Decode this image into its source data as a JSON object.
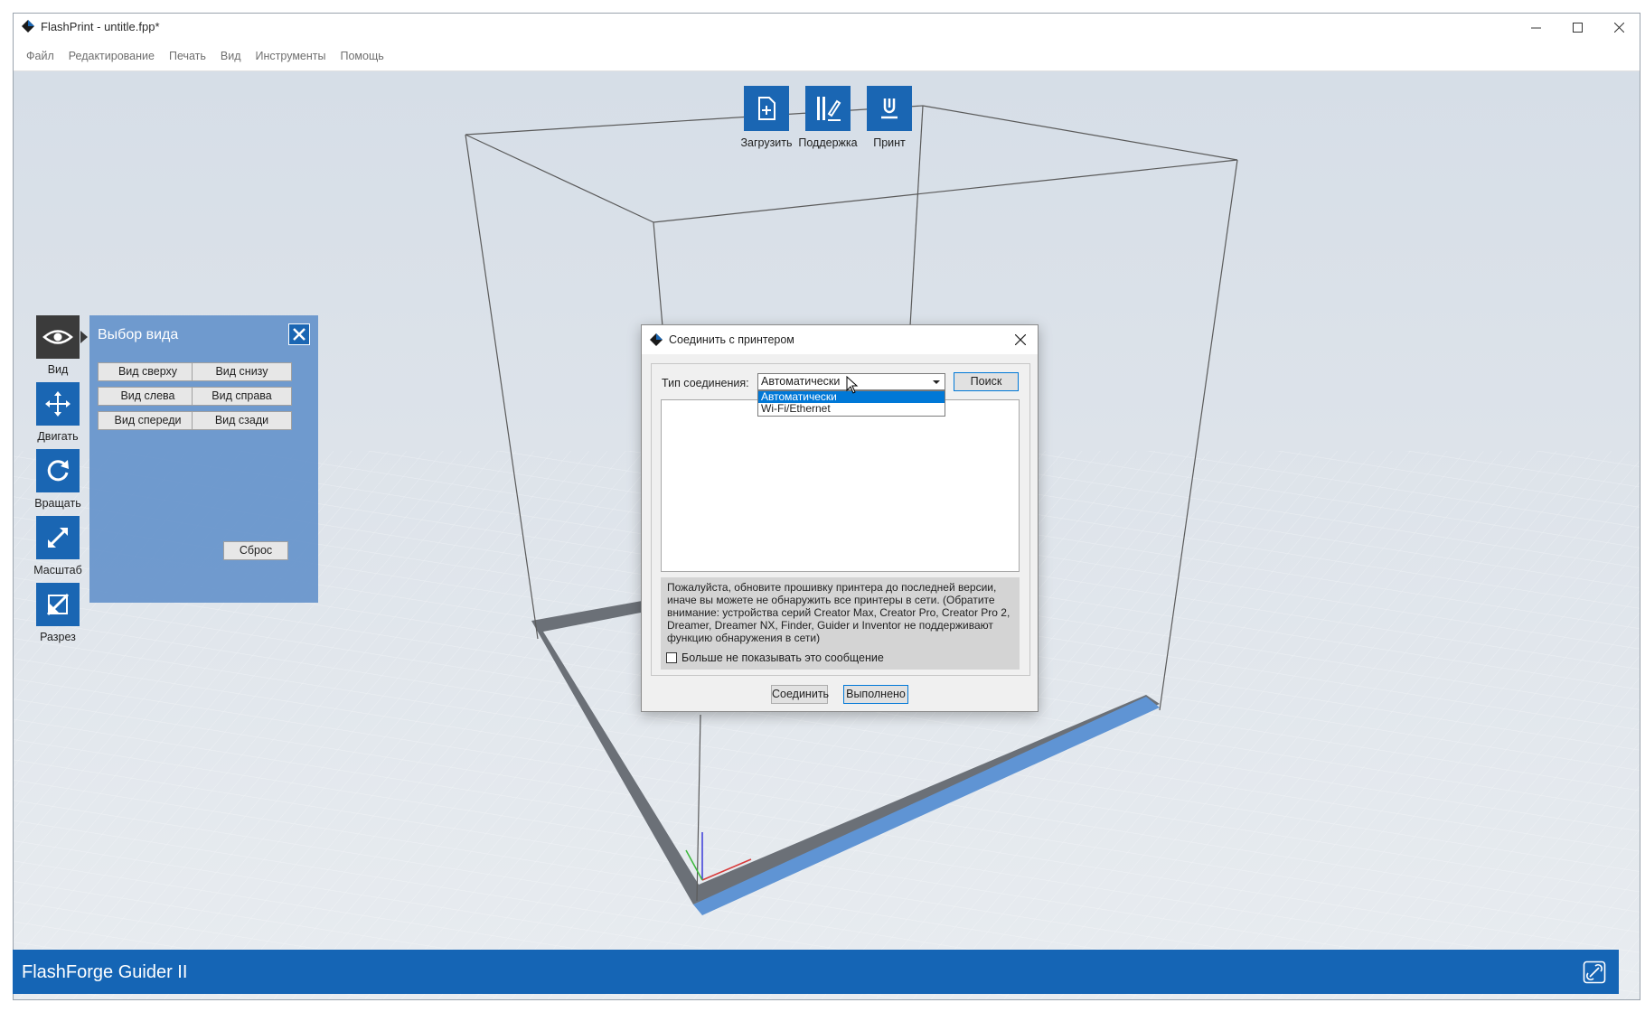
{
  "window": {
    "title": "FlashPrint - untitle.fpp*"
  },
  "menu": [
    "Файл",
    "Редактирование",
    "Печать",
    "Вид",
    "Инструменты",
    "Помощь"
  ],
  "top_tools": [
    {
      "label": "Загрузить",
      "icon": "load-file-icon"
    },
    {
      "label": "Поддержка",
      "icon": "support-icon"
    },
    {
      "label": "Принт",
      "icon": "print-icon"
    }
  ],
  "left_tools": [
    {
      "label": "Вид",
      "icon": "eye-icon",
      "active": true
    },
    {
      "label": "Двигать",
      "icon": "move-icon"
    },
    {
      "label": "Вращать",
      "icon": "rotate-icon"
    },
    {
      "label": "Масштаб",
      "icon": "scale-icon"
    },
    {
      "label": "Разрез",
      "icon": "cut-icon"
    }
  ],
  "view_panel": {
    "title": "Выбор вида",
    "buttons": [
      "Вид сверху",
      "Вид снизу",
      "Вид слева",
      "Вид справа",
      "Вид спереди",
      "Вид сзади"
    ],
    "reset_label": "Сброс"
  },
  "dialog": {
    "title": "Соединить с принтером",
    "connection_label": "Тип соединения:",
    "connection_value": "Автоматически",
    "connection_options": [
      "Автоматически",
      "Wi-Fi/Ethernet"
    ],
    "search_label": "Поиск",
    "notice": "Пожалуйста, обновите прошивку принтера до последней версии, иначе вы можете не обнаружить все принтеры в сети. (Обратите внимание: устройства серий Creator Max, Creator Pro, Creator Pro 2, Dreamer, Dreamer NX, Finder, Guider и Inventor не поддерживают функцию обнаружения в сети)",
    "dont_show_label": "Больше не показывать это сообщение",
    "connect_label": "Соединить",
    "done_label": "Выполнено"
  },
  "status_bar": {
    "printer_name": "FlashForge Guider II"
  },
  "colors": {
    "accent": "#1a66b3",
    "status_bar": "#1565b5",
    "selection": "#0078d7"
  }
}
